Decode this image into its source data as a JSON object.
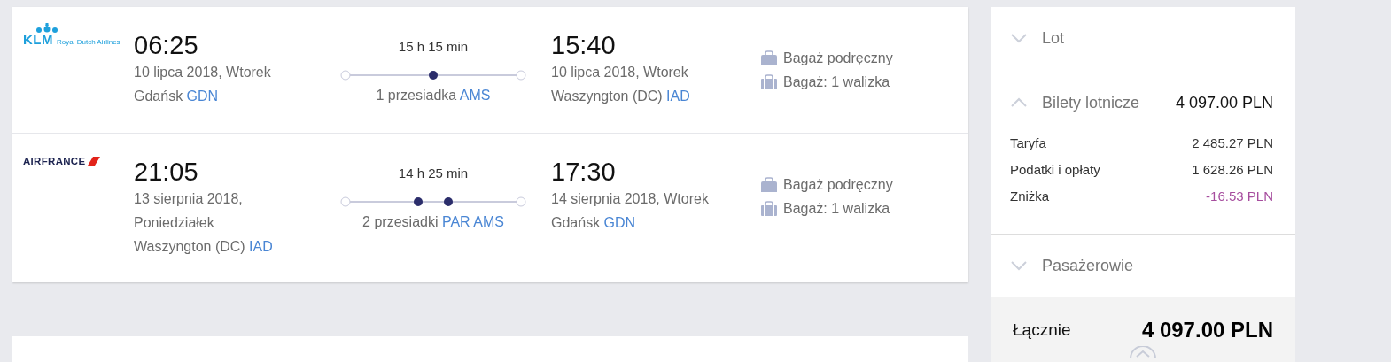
{
  "flights": [
    {
      "airline": {
        "kind": "klm",
        "name": "KLM",
        "tagline": "Royal Dutch Airlines"
      },
      "departure": {
        "time": "06:25",
        "date": "10 lipca 2018, Wtorek",
        "city": "Gdańsk",
        "code": "GDN"
      },
      "duration": "15 h 15 min",
      "stops_label": "1 przesiadka",
      "stops": [
        "AMS"
      ],
      "arrival": {
        "time": "15:40",
        "date": "10 lipca 2018, Wtorek",
        "city": "Waszyngton (DC)",
        "code": "IAD"
      },
      "baggage": [
        {
          "kind": "cabin",
          "label": "Bagaż podręczny"
        },
        {
          "kind": "checked",
          "label": "Bagaż: 1 walizka"
        }
      ]
    },
    {
      "airline": {
        "kind": "airfrance",
        "name": "AIRFRANCE"
      },
      "departure": {
        "time": "21:05",
        "date": "13 sierpnia 2018, Poniedziałek",
        "city": "Waszyngton (DC)",
        "code": "IAD"
      },
      "duration": "14 h 25 min",
      "stops_label": "2 przesiadki",
      "stops": [
        "PAR",
        "AMS"
      ],
      "arrival": {
        "time": "17:30",
        "date": "14 sierpnia 2018, Wtorek",
        "city": "Gdańsk",
        "code": "GDN"
      },
      "baggage": [
        {
          "kind": "cabin",
          "label": "Bagaż podręczny"
        },
        {
          "kind": "checked",
          "label": "Bagaż: 1 walizka"
        }
      ]
    }
  ],
  "summary": {
    "sections": [
      {
        "title": "Lot",
        "expanded": false
      },
      {
        "title": "Bilety lotnicze",
        "expanded": true,
        "amount": "4 097.00 PLN",
        "items": [
          {
            "kind": "charge",
            "label": "Taryfa",
            "amount": "2 485.27 PLN"
          },
          {
            "kind": "charge",
            "label": "Podatki i opłaty",
            "amount": "1 628.26 PLN"
          },
          {
            "kind": "discount",
            "label": "Zniżka",
            "amount": "-16.53 PLN"
          }
        ]
      },
      {
        "title": "Pasażerowie",
        "expanded": false
      }
    ],
    "total": {
      "label": "Łącznie",
      "amount": "4 097.00 PLN"
    }
  }
}
